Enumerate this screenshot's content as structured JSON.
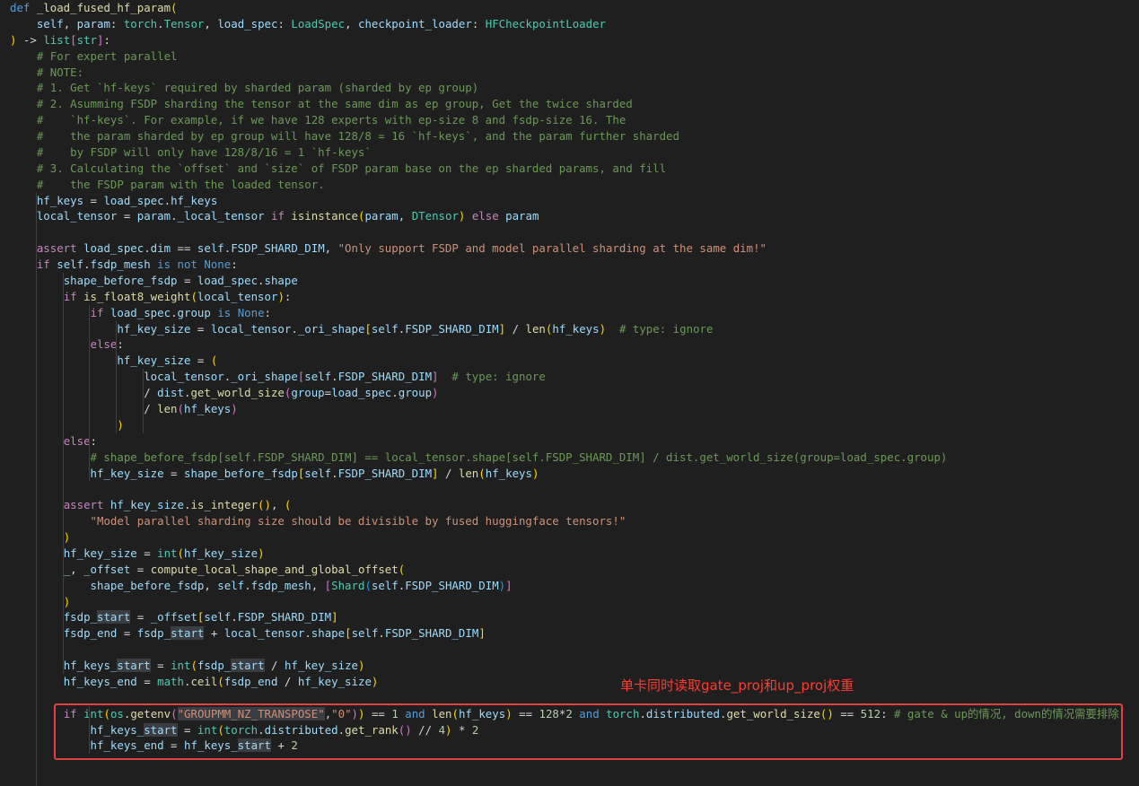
{
  "annotation": {
    "text": "单卡同时读取gate_proj和up_proj权重",
    "color": "#e0433d"
  },
  "code_lines": [
    [
      {
        "t": "def ",
        "c": "kw"
      },
      {
        "t": "_load_fused_hf_param",
        "c": "fn"
      },
      {
        "t": "(",
        "c": "b1"
      }
    ],
    [
      {
        "t": "    ",
        "c": "op"
      },
      {
        "t": "self",
        "c": "var"
      },
      {
        "t": ", ",
        "c": "op"
      },
      {
        "t": "param",
        "c": "var"
      },
      {
        "t": ": ",
        "c": "op"
      },
      {
        "t": "torch",
        "c": "type"
      },
      {
        "t": ".",
        "c": "op"
      },
      {
        "t": "Tensor",
        "c": "type"
      },
      {
        "t": ", ",
        "c": "op"
      },
      {
        "t": "load_spec",
        "c": "var"
      },
      {
        "t": ": ",
        "c": "op"
      },
      {
        "t": "LoadSpec",
        "c": "type"
      },
      {
        "t": ", ",
        "c": "op"
      },
      {
        "t": "checkpoint_loader",
        "c": "var"
      },
      {
        "t": ": ",
        "c": "op"
      },
      {
        "t": "HFCheckpointLoader",
        "c": "type"
      }
    ],
    [
      {
        "t": ")",
        "c": "b1"
      },
      {
        "t": " -> ",
        "c": "op"
      },
      {
        "t": "list",
        "c": "type"
      },
      {
        "t": "[",
        "c": "b2"
      },
      {
        "t": "str",
        "c": "type"
      },
      {
        "t": "]",
        "c": "b2"
      },
      {
        "t": ":",
        "c": "op"
      }
    ],
    [
      {
        "t": "    # For expert parallel",
        "c": "cmt"
      }
    ],
    [
      {
        "t": "    # NOTE:",
        "c": "cmt"
      }
    ],
    [
      {
        "t": "    # 1. Get `hf-keys` required by sharded param (sharded by ep group)",
        "c": "cmt"
      }
    ],
    [
      {
        "t": "    # 2. Asumming FSDP sharding the tensor at the same dim as ep group, Get the twice sharded",
        "c": "cmt"
      }
    ],
    [
      {
        "t": "    #    `hf-keys`. For example, if we have 128 experts with ep-size 8 and fsdp-size 16. The",
        "c": "cmt"
      }
    ],
    [
      {
        "t": "    #    the param sharded by ep group will have 128/8 = 16 `hf-keys`, and the param further sharded",
        "c": "cmt"
      }
    ],
    [
      {
        "t": "    #    by FSDP will only have 128/8/16 = 1 `hf-keys`",
        "c": "cmt"
      }
    ],
    [
      {
        "t": "    # 3. Calculating the `offset` and `size` of FSDP param base on the ep sharded params, and fill",
        "c": "cmt"
      }
    ],
    [
      {
        "t": "    #    the FSDP param with the loaded tensor.",
        "c": "cmt"
      }
    ],
    [
      {
        "t": "    ",
        "c": "op"
      },
      {
        "t": "hf_keys",
        "c": "var"
      },
      {
        "t": " = ",
        "c": "op"
      },
      {
        "t": "load_spec",
        "c": "var"
      },
      {
        "t": ".",
        "c": "op"
      },
      {
        "t": "hf_keys",
        "c": "var"
      }
    ],
    [
      {
        "t": "    ",
        "c": "op"
      },
      {
        "t": "local_tensor",
        "c": "var"
      },
      {
        "t": " = ",
        "c": "op"
      },
      {
        "t": "param",
        "c": "var"
      },
      {
        "t": ".",
        "c": "op"
      },
      {
        "t": "_local_tensor",
        "c": "var"
      },
      {
        "t": " if ",
        "c": "ctl"
      },
      {
        "t": "isinstance",
        "c": "fn"
      },
      {
        "t": "(",
        "c": "b1"
      },
      {
        "t": "param",
        "c": "var"
      },
      {
        "t": ", ",
        "c": "op"
      },
      {
        "t": "DTensor",
        "c": "type"
      },
      {
        "t": ")",
        "c": "b1"
      },
      {
        "t": " else ",
        "c": "ctl"
      },
      {
        "t": "param",
        "c": "var"
      }
    ],
    [],
    [
      {
        "t": "    ",
        "c": "op"
      },
      {
        "t": "assert ",
        "c": "ctl"
      },
      {
        "t": "load_spec",
        "c": "var"
      },
      {
        "t": ".",
        "c": "op"
      },
      {
        "t": "dim",
        "c": "var"
      },
      {
        "t": " == ",
        "c": "op"
      },
      {
        "t": "self",
        "c": "var"
      },
      {
        "t": ".",
        "c": "op"
      },
      {
        "t": "FSDP_SHARD_DIM",
        "c": "var"
      },
      {
        "t": ", ",
        "c": "op"
      },
      {
        "t": "\"Only support FSDP and model parallel sharding at the same dim!\"",
        "c": "str"
      }
    ],
    [
      {
        "t": "    ",
        "c": "op"
      },
      {
        "t": "if ",
        "c": "ctl"
      },
      {
        "t": "self",
        "c": "var"
      },
      {
        "t": ".",
        "c": "op"
      },
      {
        "t": "fsdp_mesh",
        "c": "var"
      },
      {
        "t": " is not ",
        "c": "kw"
      },
      {
        "t": "None",
        "c": "kw"
      },
      {
        "t": ":",
        "c": "op"
      }
    ],
    [
      {
        "t": "        ",
        "c": "op"
      },
      {
        "t": "shape_before_fsdp",
        "c": "var"
      },
      {
        "t": " = ",
        "c": "op"
      },
      {
        "t": "load_spec",
        "c": "var"
      },
      {
        "t": ".",
        "c": "op"
      },
      {
        "t": "shape",
        "c": "var"
      }
    ],
    [
      {
        "t": "        ",
        "c": "op"
      },
      {
        "t": "if ",
        "c": "ctl"
      },
      {
        "t": "is_float8_weight",
        "c": "fn"
      },
      {
        "t": "(",
        "c": "b1"
      },
      {
        "t": "local_tensor",
        "c": "var"
      },
      {
        "t": ")",
        "c": "b1"
      },
      {
        "t": ":",
        "c": "op"
      }
    ],
    [
      {
        "t": "            ",
        "c": "op"
      },
      {
        "t": "if ",
        "c": "ctl"
      },
      {
        "t": "load_spec",
        "c": "var"
      },
      {
        "t": ".",
        "c": "op"
      },
      {
        "t": "group",
        "c": "var"
      },
      {
        "t": " is ",
        "c": "kw"
      },
      {
        "t": "None",
        "c": "kw"
      },
      {
        "t": ":",
        "c": "op"
      }
    ],
    [
      {
        "t": "                ",
        "c": "op"
      },
      {
        "t": "hf_key_size",
        "c": "var"
      },
      {
        "t": " = ",
        "c": "op"
      },
      {
        "t": "local_tensor",
        "c": "var"
      },
      {
        "t": ".",
        "c": "op"
      },
      {
        "t": "_ori_shape",
        "c": "var"
      },
      {
        "t": "[",
        "c": "b1"
      },
      {
        "t": "self",
        "c": "var"
      },
      {
        "t": ".",
        "c": "op"
      },
      {
        "t": "FSDP_SHARD_DIM",
        "c": "var"
      },
      {
        "t": "]",
        "c": "b1"
      },
      {
        "t": " / ",
        "c": "op"
      },
      {
        "t": "len",
        "c": "fn"
      },
      {
        "t": "(",
        "c": "b1"
      },
      {
        "t": "hf_keys",
        "c": "var"
      },
      {
        "t": ")",
        "c": "b1"
      },
      {
        "t": "  # type: ignore",
        "c": "cmt"
      }
    ],
    [
      {
        "t": "            ",
        "c": "op"
      },
      {
        "t": "else",
        "c": "ctl"
      },
      {
        "t": ":",
        "c": "op"
      }
    ],
    [
      {
        "t": "                ",
        "c": "op"
      },
      {
        "t": "hf_key_size",
        "c": "var"
      },
      {
        "t": " = ",
        "c": "op"
      },
      {
        "t": "(",
        "c": "b1"
      }
    ],
    [
      {
        "t": "                    ",
        "c": "op"
      },
      {
        "t": "local_tensor",
        "c": "var"
      },
      {
        "t": ".",
        "c": "op"
      },
      {
        "t": "_ori_shape",
        "c": "var"
      },
      {
        "t": "[",
        "c": "b2"
      },
      {
        "t": "self",
        "c": "var"
      },
      {
        "t": ".",
        "c": "op"
      },
      {
        "t": "FSDP_SHARD_DIM",
        "c": "var"
      },
      {
        "t": "]",
        "c": "b2"
      },
      {
        "t": "  # type: ignore",
        "c": "cmt"
      }
    ],
    [
      {
        "t": "                    / ",
        "c": "op"
      },
      {
        "t": "dist",
        "c": "var"
      },
      {
        "t": ".",
        "c": "op"
      },
      {
        "t": "get_world_size",
        "c": "fn"
      },
      {
        "t": "(",
        "c": "b2"
      },
      {
        "t": "group",
        "c": "var"
      },
      {
        "t": "=",
        "c": "op"
      },
      {
        "t": "load_spec",
        "c": "var"
      },
      {
        "t": ".",
        "c": "op"
      },
      {
        "t": "group",
        "c": "var"
      },
      {
        "t": ")",
        "c": "b2"
      }
    ],
    [
      {
        "t": "                    / ",
        "c": "op"
      },
      {
        "t": "len",
        "c": "fn"
      },
      {
        "t": "(",
        "c": "b2"
      },
      {
        "t": "hf_keys",
        "c": "var"
      },
      {
        "t": ")",
        "c": "b2"
      }
    ],
    [
      {
        "t": "                ",
        "c": "op"
      },
      {
        "t": ")",
        "c": "b1"
      }
    ],
    [
      {
        "t": "        ",
        "c": "op"
      },
      {
        "t": "else",
        "c": "ctl"
      },
      {
        "t": ":",
        "c": "op"
      }
    ],
    [
      {
        "t": "            # shape_before_fsdp[self.FSDP_SHARD_DIM] == local_tensor.shape[self.FSDP_SHARD_DIM] / dist.get_world_size(group=load_spec.group)",
        "c": "cmt"
      }
    ],
    [
      {
        "t": "            ",
        "c": "op"
      },
      {
        "t": "hf_key_size",
        "c": "var"
      },
      {
        "t": " = ",
        "c": "op"
      },
      {
        "t": "shape_before_fsdp",
        "c": "var"
      },
      {
        "t": "[",
        "c": "b1"
      },
      {
        "t": "self",
        "c": "var"
      },
      {
        "t": ".",
        "c": "op"
      },
      {
        "t": "FSDP_SHARD_DIM",
        "c": "var"
      },
      {
        "t": "]",
        "c": "b1"
      },
      {
        "t": " / ",
        "c": "op"
      },
      {
        "t": "len",
        "c": "fn"
      },
      {
        "t": "(",
        "c": "b1"
      },
      {
        "t": "hf_keys",
        "c": "var"
      },
      {
        "t": ")",
        "c": "b1"
      }
    ],
    [],
    [
      {
        "t": "        ",
        "c": "op"
      },
      {
        "t": "assert ",
        "c": "ctl"
      },
      {
        "t": "hf_key_size",
        "c": "var"
      },
      {
        "t": ".",
        "c": "op"
      },
      {
        "t": "is_integer",
        "c": "fn"
      },
      {
        "t": "(",
        "c": "b1"
      },
      {
        "t": ")",
        "c": "b1"
      },
      {
        "t": ", ",
        "c": "op"
      },
      {
        "t": "(",
        "c": "b1"
      }
    ],
    [
      {
        "t": "            ",
        "c": "op"
      },
      {
        "t": "\"Model parallel sharding size should be divisible by fused huggingface tensors!\"",
        "c": "str"
      }
    ],
    [
      {
        "t": "        ",
        "c": "op"
      },
      {
        "t": ")",
        "c": "b1"
      }
    ],
    [
      {
        "t": "        ",
        "c": "op"
      },
      {
        "t": "hf_key_size",
        "c": "var"
      },
      {
        "t": " = ",
        "c": "op"
      },
      {
        "t": "int",
        "c": "type"
      },
      {
        "t": "(",
        "c": "b1"
      },
      {
        "t": "hf_key_size",
        "c": "var"
      },
      {
        "t": ")",
        "c": "b1"
      }
    ],
    [
      {
        "t": "        ",
        "c": "op"
      },
      {
        "t": "_",
        "c": "var"
      },
      {
        "t": ", ",
        "c": "op"
      },
      {
        "t": "_offset",
        "c": "var"
      },
      {
        "t": " = ",
        "c": "op"
      },
      {
        "t": "compute_local_shape_and_global_offset",
        "c": "fn"
      },
      {
        "t": "(",
        "c": "b1"
      }
    ],
    [
      {
        "t": "            ",
        "c": "op"
      },
      {
        "t": "shape_before_fsdp",
        "c": "var"
      },
      {
        "t": ", ",
        "c": "op"
      },
      {
        "t": "self",
        "c": "var"
      },
      {
        "t": ".",
        "c": "op"
      },
      {
        "t": "fsdp_mesh",
        "c": "var"
      },
      {
        "t": ", ",
        "c": "op"
      },
      {
        "t": "[",
        "c": "b2"
      },
      {
        "t": "Shard",
        "c": "type"
      },
      {
        "t": "(",
        "c": "b3"
      },
      {
        "t": "self",
        "c": "var"
      },
      {
        "t": ".",
        "c": "op"
      },
      {
        "t": "FSDP_SHARD_DIM",
        "c": "var"
      },
      {
        "t": ")",
        "c": "b3"
      },
      {
        "t": "]",
        "c": "b2"
      }
    ],
    [
      {
        "t": "        ",
        "c": "op"
      },
      {
        "t": ")",
        "c": "b1"
      }
    ],
    [
      {
        "t": "        ",
        "c": "op"
      },
      {
        "t": "fsdp_",
        "c": "var"
      },
      {
        "t": "start",
        "c": "var",
        "hl": true
      },
      {
        "t": " = ",
        "c": "op"
      },
      {
        "t": "_offset",
        "c": "var"
      },
      {
        "t": "[",
        "c": "b1"
      },
      {
        "t": "self",
        "c": "var"
      },
      {
        "t": ".",
        "c": "op"
      },
      {
        "t": "FSDP_SHARD_DIM",
        "c": "var"
      },
      {
        "t": "]",
        "c": "b1"
      }
    ],
    [
      {
        "t": "        ",
        "c": "op"
      },
      {
        "t": "fsdp_end",
        "c": "var"
      },
      {
        "t": " = ",
        "c": "op"
      },
      {
        "t": "fsdp_",
        "c": "var"
      },
      {
        "t": "start",
        "c": "var",
        "hl": true
      },
      {
        "t": " + ",
        "c": "op"
      },
      {
        "t": "local_tensor",
        "c": "var"
      },
      {
        "t": ".",
        "c": "op"
      },
      {
        "t": "shape",
        "c": "var"
      },
      {
        "t": "[",
        "c": "b1"
      },
      {
        "t": "self",
        "c": "var"
      },
      {
        "t": ".",
        "c": "op"
      },
      {
        "t": "FSDP_SHARD_DIM",
        "c": "var"
      },
      {
        "t": "]",
        "c": "b1"
      }
    ],
    [],
    [
      {
        "t": "        ",
        "c": "op"
      },
      {
        "t": "hf_keys_",
        "c": "var"
      },
      {
        "t": "start",
        "c": "var",
        "hl": true
      },
      {
        "t": " = ",
        "c": "op"
      },
      {
        "t": "int",
        "c": "type"
      },
      {
        "t": "(",
        "c": "b1"
      },
      {
        "t": "fsdp_",
        "c": "var"
      },
      {
        "t": "start",
        "c": "var",
        "hl": true
      },
      {
        "t": " / ",
        "c": "op"
      },
      {
        "t": "hf_key_size",
        "c": "var"
      },
      {
        "t": ")",
        "c": "b1"
      }
    ],
    [
      {
        "t": "        ",
        "c": "op"
      },
      {
        "t": "hf_keys_end",
        "c": "var"
      },
      {
        "t": " = ",
        "c": "op"
      },
      {
        "t": "math",
        "c": "type"
      },
      {
        "t": ".",
        "c": "op"
      },
      {
        "t": "ceil",
        "c": "fn"
      },
      {
        "t": "(",
        "c": "b1"
      },
      {
        "t": "fsdp_end",
        "c": "var"
      },
      {
        "t": " / ",
        "c": "op"
      },
      {
        "t": "hf_key_size",
        "c": "var"
      },
      {
        "t": ")",
        "c": "b1"
      }
    ],
    [],
    [
      {
        "t": "        ",
        "c": "op"
      },
      {
        "t": "if ",
        "c": "ctl"
      },
      {
        "t": "int",
        "c": "type"
      },
      {
        "t": "(",
        "c": "b1"
      },
      {
        "t": "os",
        "c": "type"
      },
      {
        "t": ".",
        "c": "op"
      },
      {
        "t": "getenv",
        "c": "fn"
      },
      {
        "t": "(",
        "c": "b2"
      },
      {
        "t": "\"GROUPMM_NZ_TRANSPOSE\"",
        "c": "str",
        "hl": true
      },
      {
        "t": ",",
        "c": "op"
      },
      {
        "t": "\"0\"",
        "c": "str"
      },
      {
        "t": ")",
        "c": "b2"
      },
      {
        "t": ")",
        "c": "b1"
      },
      {
        "t": " == ",
        "c": "op"
      },
      {
        "t": "1",
        "c": "num"
      },
      {
        "t": " and ",
        "c": "kw"
      },
      {
        "t": "len",
        "c": "fn"
      },
      {
        "t": "(",
        "c": "b1"
      },
      {
        "t": "hf_keys",
        "c": "var"
      },
      {
        "t": ")",
        "c": "b1"
      },
      {
        "t": " == ",
        "c": "op"
      },
      {
        "t": "128",
        "c": "num"
      },
      {
        "t": "*",
        "c": "op"
      },
      {
        "t": "2",
        "c": "num"
      },
      {
        "t": " and ",
        "c": "kw"
      },
      {
        "t": "torch",
        "c": "type"
      },
      {
        "t": ".",
        "c": "op"
      },
      {
        "t": "distributed",
        "c": "var"
      },
      {
        "t": ".",
        "c": "op"
      },
      {
        "t": "get_world_size",
        "c": "fn"
      },
      {
        "t": "(",
        "c": "b1"
      },
      {
        "t": ")",
        "c": "b1"
      },
      {
        "t": " == ",
        "c": "op"
      },
      {
        "t": "512",
        "c": "num"
      },
      {
        "t": ": ",
        "c": "op"
      },
      {
        "t": "# gate & up的情况, down的情况需要排除",
        "c": "cmt"
      }
    ],
    [
      {
        "t": "            ",
        "c": "op"
      },
      {
        "t": "hf_keys_",
        "c": "var"
      },
      {
        "t": "start",
        "c": "var",
        "hl": true
      },
      {
        "t": " = ",
        "c": "op"
      },
      {
        "t": "int",
        "c": "type"
      },
      {
        "t": "(",
        "c": "b1"
      },
      {
        "t": "torch",
        "c": "type"
      },
      {
        "t": ".",
        "c": "op"
      },
      {
        "t": "distributed",
        "c": "var"
      },
      {
        "t": ".",
        "c": "op"
      },
      {
        "t": "get_rank",
        "c": "fn"
      },
      {
        "t": "(",
        "c": "b2"
      },
      {
        "t": ")",
        "c": "b2"
      },
      {
        "t": " // ",
        "c": "op"
      },
      {
        "t": "4",
        "c": "num"
      },
      {
        "t": ")",
        "c": "b1"
      },
      {
        "t": " * ",
        "c": "op"
      },
      {
        "t": "2",
        "c": "num"
      }
    ],
    [
      {
        "t": "            ",
        "c": "op"
      },
      {
        "t": "hf_keys_end",
        "c": "var"
      },
      {
        "t": " = ",
        "c": "op"
      },
      {
        "t": "hf_keys_",
        "c": "var"
      },
      {
        "t": "start",
        "c": "var",
        "hl": true
      },
      {
        "t": " + ",
        "c": "op"
      },
      {
        "t": "2",
        "c": "num"
      }
    ]
  ]
}
